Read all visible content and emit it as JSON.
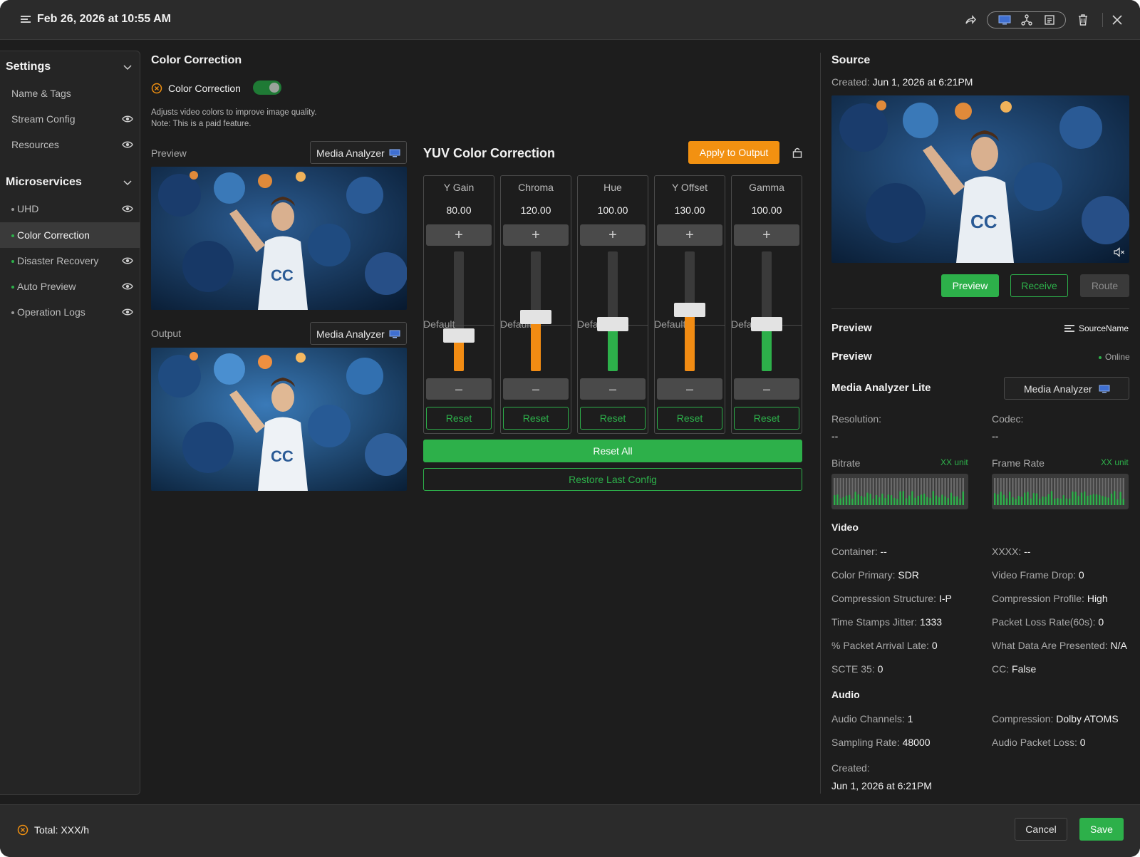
{
  "titlebar": {
    "title": "Feb 26, 2026 at 10:55 AM",
    "icons": [
      "srt-icon",
      "share-icon",
      "monitor-icon",
      "topology-icon",
      "document-icon",
      "trash-icon",
      "close-icon"
    ]
  },
  "sidebar": {
    "settings_heading": "Settings",
    "settings_items": [
      {
        "label": "Name & Tags",
        "eye": false
      },
      {
        "label": "Stream Config",
        "eye": true
      },
      {
        "label": "Resources",
        "eye": true
      }
    ],
    "microservices_heading": "Microservices",
    "microservice_items": [
      {
        "label": "UHD",
        "dot": "grey",
        "eye": true,
        "active": false
      },
      {
        "label": "Color Correction",
        "dot": "green",
        "eye": false,
        "active": true
      },
      {
        "label": "Disaster Recovery",
        "dot": "green",
        "eye": true,
        "active": false
      },
      {
        "label": "Auto Preview",
        "dot": "green",
        "eye": true,
        "active": false
      },
      {
        "label": "Operation Logs",
        "dot": "grey",
        "eye": true,
        "active": false
      }
    ]
  },
  "main": {
    "title": "Color Correction",
    "toggle_label": "Color Correction",
    "toggle_on": true,
    "description_line1": "Adjusts video colors to improve image quality.",
    "description_line2": "Note: This is a paid feature.",
    "preview_label": "Preview",
    "output_label": "Output",
    "analyzer_select": "Media Analyzer",
    "yuv_title": "YUV Color Correction",
    "apply_button": "Apply to Output",
    "default_label": "Default",
    "plus_symbol": "+",
    "minus_symbol": "–",
    "reset_label": "Reset",
    "columns": [
      {
        "name": "Y Gain",
        "value": "80.00",
        "level": 0.3,
        "color": "#f28c13"
      },
      {
        "name": "Chroma",
        "value": "120.00",
        "level": 0.45,
        "color": "#f28c13"
      },
      {
        "name": "Hue",
        "value": "100.00",
        "level": 0.39,
        "color": "#2db04a"
      },
      {
        "name": "Y Offset",
        "value": "130.00",
        "level": 0.51,
        "color": "#f28c13"
      },
      {
        "name": "Gamma",
        "value": "100.00",
        "level": 0.39,
        "color": "#2db04a"
      }
    ],
    "reset_all": "Reset All",
    "restore_last": "Restore Last Config"
  },
  "source": {
    "title": "Source",
    "created_label": "Created:",
    "created_value": "Jun 1, 2026 at 6:21PM",
    "preview_btn": "Preview",
    "receive_btn": "Receive",
    "route_btn": "Route",
    "preview_heading": "Preview",
    "source_name": "SourceName",
    "preview_heading2": "Preview",
    "status": "Online",
    "analyzer_title": "Media Analyzer Lite",
    "analyzer_select": "Media Analyzer",
    "resolution_label": "Resolution:",
    "resolution_value": "--",
    "codec_label": "Codec:",
    "codec_value": "--",
    "bitrate_label": "Bitrate",
    "bitrate_unit": "XX unit",
    "framerate_label": "Frame Rate",
    "framerate_unit": "XX unit",
    "video_heading": "Video",
    "video": [
      {
        "label": "Container:",
        "value": "--"
      },
      {
        "label": "XXXX:",
        "value": "--"
      },
      {
        "label": "Color Primary:",
        "value": "SDR"
      },
      {
        "label": "Video Frame Drop:",
        "value": "0"
      },
      {
        "label": "Compression Structure:",
        "value": "I-P"
      },
      {
        "label": "Compression Profile:",
        "value": "High"
      },
      {
        "label": "Time Stamps Jitter:",
        "value": "1333"
      },
      {
        "label": "Packet Loss Rate(60s):",
        "value": "0"
      },
      {
        "label": "% Packet Arrival Late:",
        "value": "0"
      },
      {
        "label": "What Data Are Presented:",
        "value": "N/A"
      },
      {
        "label": "SCTE 35:",
        "value": "0"
      },
      {
        "label": "CC:",
        "value": "False"
      }
    ],
    "audio_heading": "Audio",
    "audio": [
      {
        "label": "Audio Channels:",
        "value": "1"
      },
      {
        "label": "Compression:",
        "value": "Dolby ATOMS"
      },
      {
        "label": "Sampling Rate:",
        "value": "48000"
      },
      {
        "label": "Audio Packet Loss:",
        "value": "0"
      }
    ],
    "footer_created_label": "Created:",
    "footer_created_value": "Jun 1, 2026 at 6:21PM"
  },
  "footer": {
    "total": "Total: XXX/h",
    "cancel": "Cancel",
    "save": "Save"
  },
  "colors": {
    "accent_green": "#2db04a",
    "accent_orange": "#f29111",
    "background": "#1d1d1d"
  }
}
